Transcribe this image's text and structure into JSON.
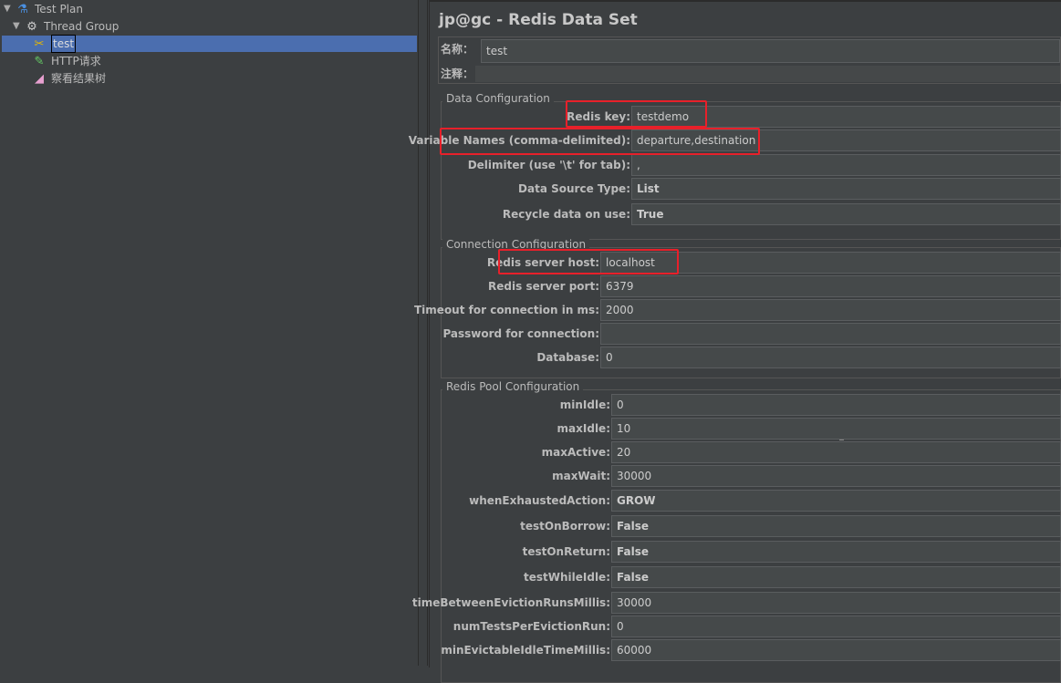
{
  "tree": [
    {
      "label": "Test Plan",
      "icon": "flask-icon"
    },
    {
      "label": "Thread Group",
      "icon": "gear-icon"
    },
    {
      "label": "test",
      "icon": "wrench-screwdriver-icon"
    },
    {
      "label": "HTTP请求",
      "icon": "pipette-icon"
    },
    {
      "label": "察看结果树",
      "icon": "chart-icon"
    }
  ],
  "title": "jp@gc - Redis Data Set",
  "name_label": "名称：",
  "name_value": "test",
  "comment_label": "注释：",
  "comment_value": "",
  "data_config": {
    "legend": "Data Configuration",
    "rows": [
      {
        "label": "Redis key:",
        "value": "testdemo"
      },
      {
        "label": "Variable Names (comma-delimited):",
        "value": "departure,destination"
      },
      {
        "label": "Delimiter (use '\\t' for tab):",
        "value": ","
      },
      {
        "label": "Data Source Type:",
        "value": "List"
      },
      {
        "label": "Recycle data on use:",
        "value": "True"
      }
    ]
  },
  "conn_config": {
    "legend": "Connection Configuration",
    "rows": [
      {
        "label": "Redis server host:",
        "value": "localhost"
      },
      {
        "label": "Redis server port:",
        "value": "6379"
      },
      {
        "label": "Timeout for connection in ms:",
        "value": "2000"
      },
      {
        "label": "Password for connection:",
        "value": ""
      },
      {
        "label": "Database:",
        "value": "0"
      }
    ]
  },
  "pool_config": {
    "legend": "Redis Pool Configuration",
    "rows": [
      {
        "label": "minIdle:",
        "value": "0"
      },
      {
        "label": "maxIdle:",
        "value": "10"
      },
      {
        "label": "maxActive:",
        "value": "20"
      },
      {
        "label": "maxWait:",
        "value": "30000"
      },
      {
        "label": "whenExhaustedAction:",
        "value": "GROW"
      },
      {
        "label": "testOnBorrow:",
        "value": "False"
      },
      {
        "label": "testOnReturn:",
        "value": "False"
      },
      {
        "label": "testWhileIdle:",
        "value": "False"
      },
      {
        "label": "timeBetweenEvictionRunsMillis:",
        "value": "30000"
      },
      {
        "label": "numTestsPerEvictionRun:",
        "value": "0"
      },
      {
        "label": "minEvictableIdleTimeMillis:",
        "value": "60000"
      }
    ]
  },
  "colors": {
    "highlight": "#e8202a",
    "selection": "#4b6eaf"
  }
}
